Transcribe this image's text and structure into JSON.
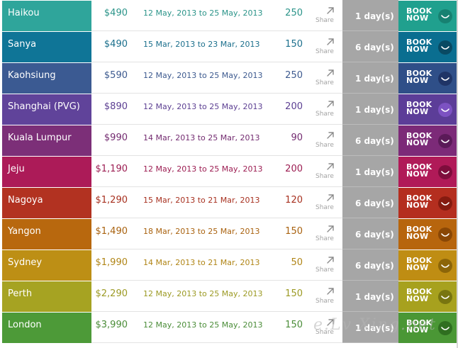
{
  "colors": {
    "share_gray": "#9a9a9a",
    "days_bg": "#a6a6a6"
  },
  "rows": [
    {
      "city": "Haikou",
      "price": "$490",
      "dates": "12 May, 2013 to 25 May, 2013",
      "count": "250",
      "share": "Share",
      "days": "1 day(s)",
      "book_line1": "BOOK",
      "book_line2": "NOW",
      "color": "#2fa59b",
      "book_color": "#20a08e",
      "icon_color": "#178171",
      "text_color": "#2b9489"
    },
    {
      "city": "Sanya",
      "price": "$490",
      "dates": "15 Mar, 2013 to 23 Mar, 2013",
      "count": "150",
      "share": "Share",
      "days": "6 day(s)",
      "book_line1": "BOOK",
      "book_line2": "NOW",
      "color": "#0f7597",
      "book_color": "#0a6e90",
      "icon_color": "#094a63",
      "text_color": "#1b6f8c"
    },
    {
      "city": "Kaohsiung",
      "price": "$590",
      "dates": "12 May, 2013 to 25 May, 2013",
      "count": "250",
      "share": "Share",
      "days": "1 day(s)",
      "book_line1": "BOOK",
      "book_line2": "NOW",
      "color": "#3b5a92",
      "book_color": "#2f4f88",
      "icon_color": "#1f3466",
      "text_color": "#3d5a8f"
    },
    {
      "city": "Shanghai (PVG)",
      "price": "$890",
      "dates": "12 May, 2013 to 25 May, 2013",
      "count": "200",
      "share": "Share",
      "days": "1 day(s)",
      "book_line1": "BOOK",
      "book_line2": "NOW",
      "color": "#60439a",
      "book_color": "#5c3d98",
      "icon_color": "#7c52c2",
      "text_color": "#5c3f92"
    },
    {
      "city": "Kuala Lumpur",
      "price": "$990",
      "dates": "14 Mar, 2013 to 25 Mar, 2013",
      "count": "90",
      "share": "Share",
      "days": "6 day(s)",
      "book_line1": "BOOK",
      "book_line2": "NOW",
      "color": "#7c2f78",
      "book_color": "#7c2a78",
      "icon_color": "#5a1a58",
      "text_color": "#732b70"
    },
    {
      "city": "Jeju",
      "price": "$1,190",
      "dates": "12 May, 2013 to 25 May, 2013",
      "count": "200",
      "share": "Share",
      "days": "1 day(s)",
      "book_line1": "BOOK",
      "book_line2": "NOW",
      "color": "#ac1b58",
      "book_color": "#b01a58",
      "icon_color": "#7e0d3c",
      "text_color": "#9c1d52"
    },
    {
      "city": "Nagoya",
      "price": "$1,290",
      "dates": "15 Mar, 2013 to 21 Mar, 2013",
      "count": "120",
      "share": "Share",
      "days": "6 day(s)",
      "book_line1": "BOOK",
      "book_line2": "NOW",
      "color": "#b23221",
      "book_color": "#b42e1f",
      "icon_color": "#851b10",
      "text_color": "#a7301f"
    },
    {
      "city": "Yangon",
      "price": "$1,490",
      "dates": "18 Mar, 2013 to 25 Mar, 2013",
      "count": "150",
      "share": "Share",
      "days": "6 day(s)",
      "book_line1": "BOOK",
      "book_line2": "NOW",
      "color": "#b8680e",
      "book_color": "#b7650d",
      "icon_color": "#8a4705",
      "text_color": "#a9620f"
    },
    {
      "city": "Sydney",
      "price": "$1,990",
      "dates": "14 Mar, 2013 to 21 Mar, 2013",
      "count": "50",
      "share": "Share",
      "days": "6 day(s)",
      "book_line1": "BOOK",
      "book_line2": "NOW",
      "color": "#bd8f15",
      "book_color": "#bf8d13",
      "icon_color": "#8c6508",
      "text_color": "#b08516"
    },
    {
      "city": "Perth",
      "price": "$2,290",
      "dates": "12 May, 2013 to 25 May, 2013",
      "count": "150",
      "share": "Share",
      "days": "1 day(s)",
      "book_line1": "BOOK",
      "book_line2": "NOW",
      "color": "#a6a322",
      "book_color": "#a7a11e",
      "icon_color": "#787510",
      "text_color": "#9c9a24"
    },
    {
      "city": "London",
      "price": "$3,990",
      "dates": "12 May, 2013 to 25 May, 2013",
      "count": "150",
      "share": "Share",
      "days": "1 day(s)",
      "book_line1": "BOOK",
      "book_line2": "NOW",
      "color": "#4d9a38",
      "book_color": "#4a9735",
      "icon_color": "#2f6f20",
      "text_color": "#4b8d39"
    }
  ],
  "watermark": "e.Lv Xing.net"
}
